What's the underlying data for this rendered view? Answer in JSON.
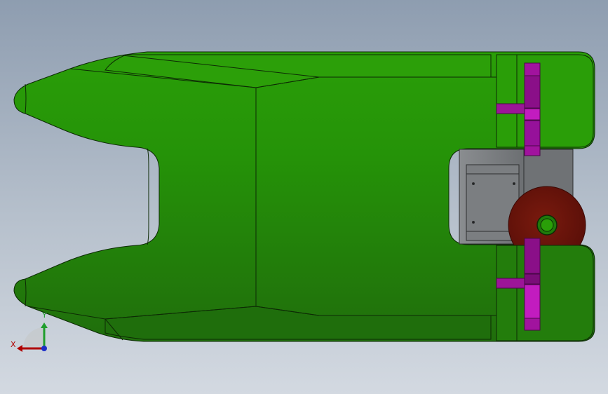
{
  "viewport": {
    "background_top": "#8e9db0",
    "background_bottom": "#d3d9e1"
  },
  "model": {
    "hull_color": "#2a9a0a",
    "hull_dark_color": "#247d0c",
    "hull_edge_color": "#0d2a05",
    "motor_color": "#7a7e80",
    "wheel_color": "#6b140b",
    "hub_color": "#2a9a0a",
    "bracket_color": "#a1139e"
  },
  "triad": {
    "x_label": "X",
    "y_label": "Y",
    "x_color": "#b00000",
    "y_color": "#1f9e2c",
    "z_color": "#1d2fc8"
  }
}
